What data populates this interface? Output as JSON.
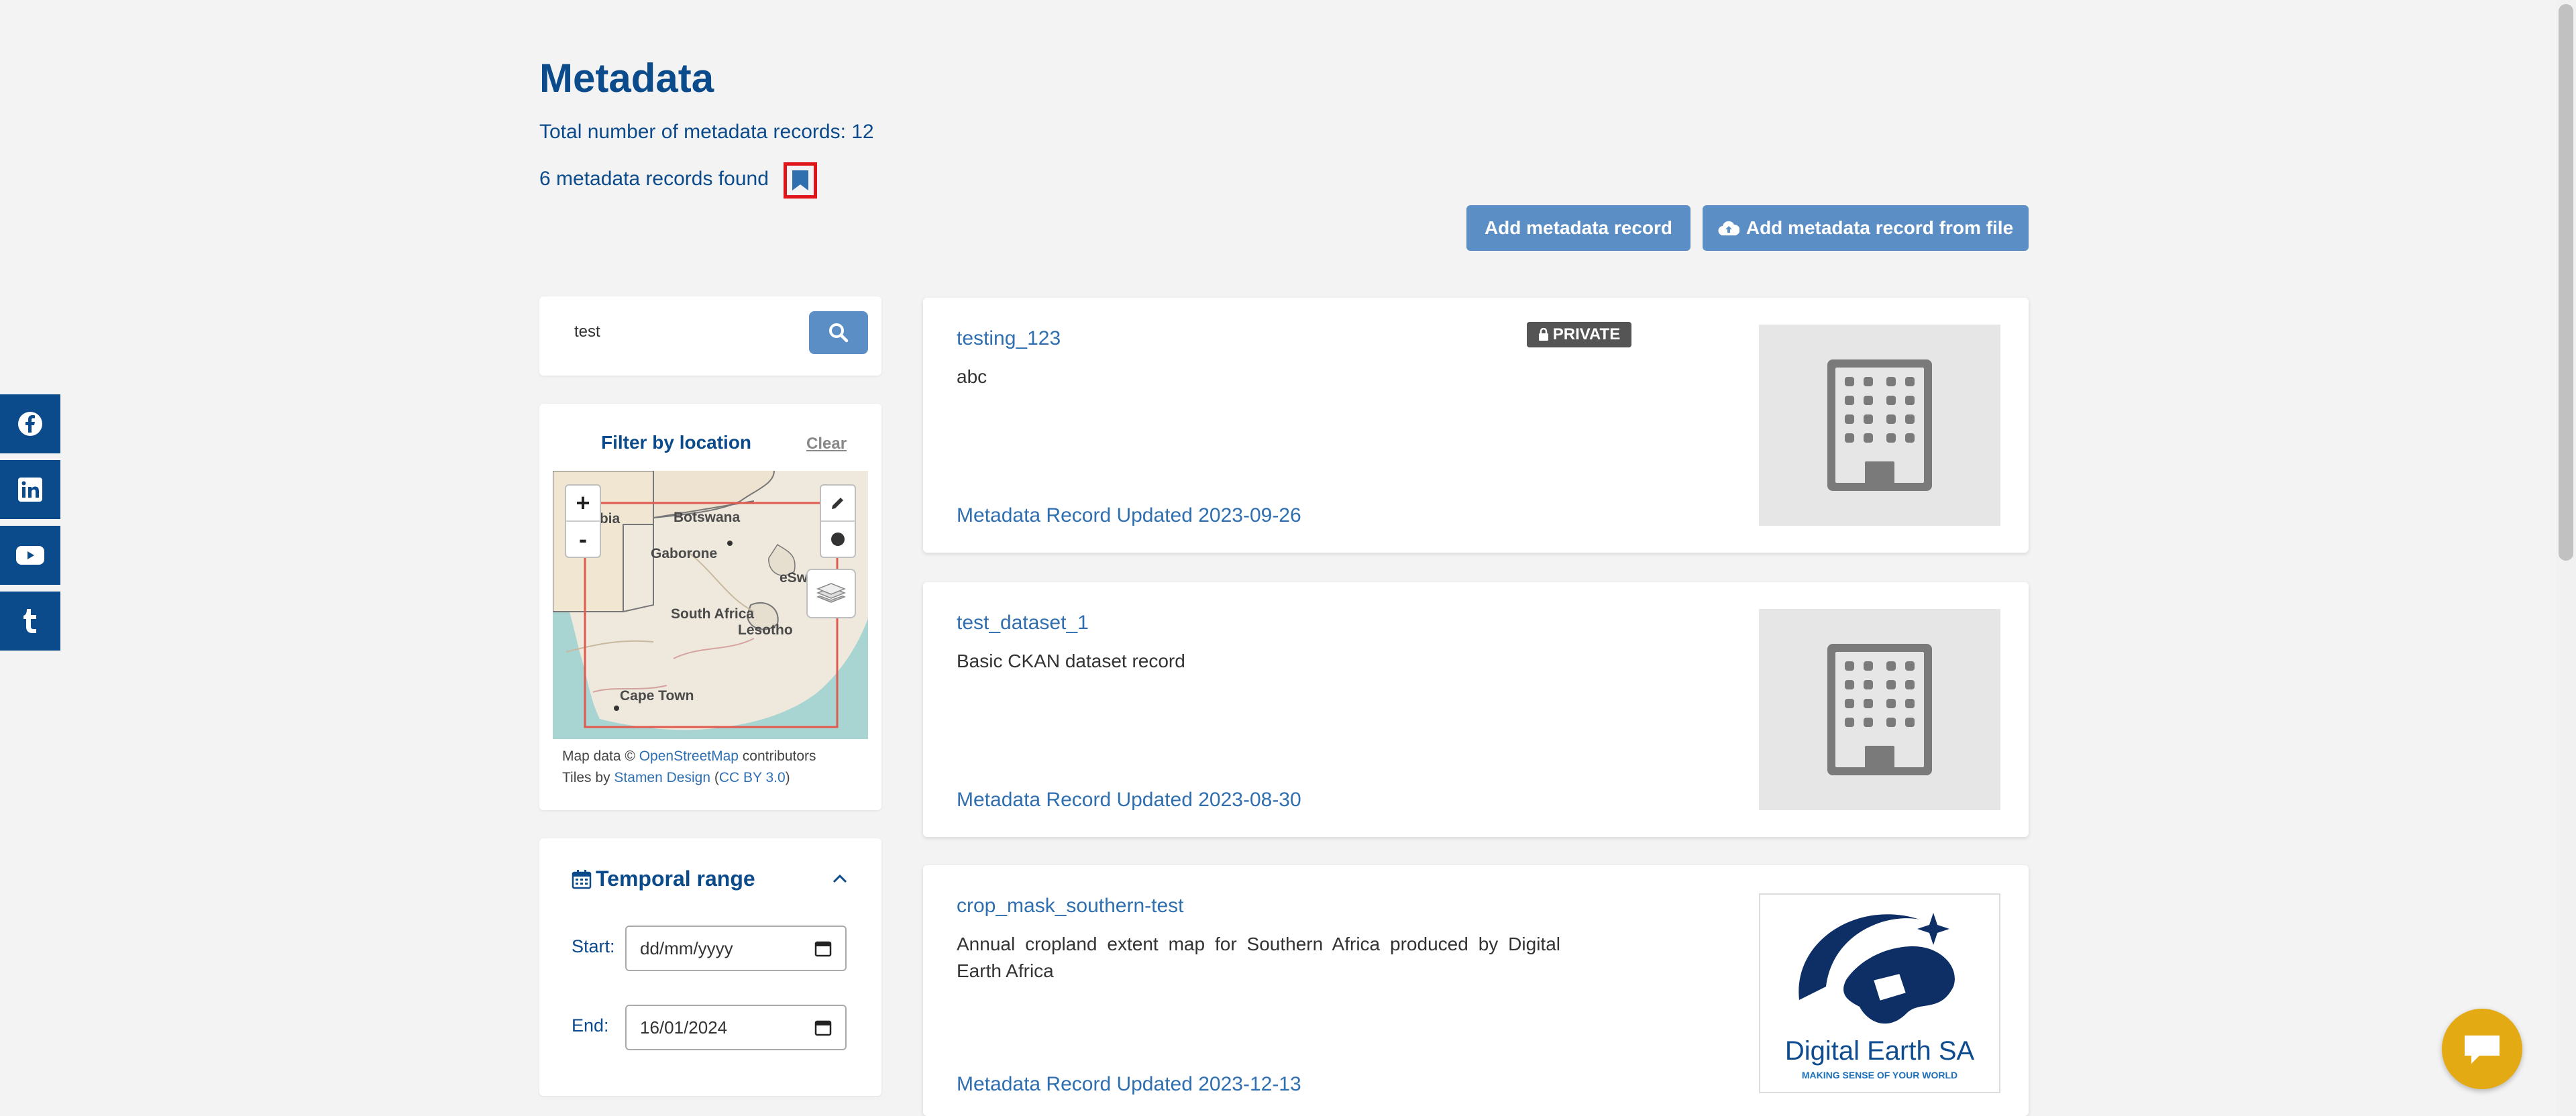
{
  "header": {
    "title": "Metadata",
    "total_records": "Total number of metadata records: 12",
    "found_records": "6 metadata records found"
  },
  "actions": {
    "add_record": "Add metadata record",
    "add_from_file": "Add metadata record from file"
  },
  "social": {
    "items": [
      "facebook-icon",
      "linkedin-icon",
      "youtube-icon",
      "tumblr-icon"
    ]
  },
  "search": {
    "value": "test"
  },
  "location_filter": {
    "title": "Filter by location",
    "clear": "Clear",
    "zoom_in": "+",
    "zoom_out": "-",
    "map_labels": {
      "namibia": "ibia",
      "botswana": "Botswana",
      "gaborone": "Gaborone",
      "south_africa": "South Africa",
      "lesotho": "Lesotho",
      "eswatini": "eSw",
      "cape_town": "Cape Town"
    },
    "attribution_line1_prefix": "Map data © ",
    "attribution_osm": "OpenStreetMap",
    "attribution_line1_suffix": " contributors",
    "attribution_line2_prefix": "Tiles by ",
    "attribution_stamen": "Stamen Design",
    "attribution_paren_open": " (",
    "attribution_cc": "CC BY 3.0",
    "attribution_paren_close": ")"
  },
  "temporal": {
    "title": "Temporal range",
    "start_label": "Start:",
    "start_value": "dd/mm/yyyy",
    "end_label": "End:",
    "end_value": "16/01/2024"
  },
  "results": [
    {
      "title": "testing_123",
      "badge": "PRIVATE",
      "description": "abc",
      "updated": "Metadata Record Updated 2023-09-26",
      "thumbnail": "building-icon"
    },
    {
      "title": "test_dataset_1",
      "description": "Basic CKAN dataset record",
      "updated": "Metadata Record Updated 2023-08-30",
      "thumbnail": "building-icon"
    },
    {
      "title": "crop_mask_southern-test",
      "description": "Annual cropland extent map for Southern Africa produced by Digital Earth Africa",
      "updated": "Metadata Record Updated 2023-12-13",
      "thumbnail": "digital-earth-sa-logo",
      "logo_text": "Digital Earth SA",
      "logo_tagline": "MAKING SENSE OF YOUR WORLD"
    }
  ],
  "colors": {
    "brand_blue": "#0b4a8b",
    "link_blue": "#2f6fb0",
    "button_blue": "#5b8ec5",
    "highlight_red": "#e0151a",
    "chat_yellow": "#e3aa14"
  }
}
